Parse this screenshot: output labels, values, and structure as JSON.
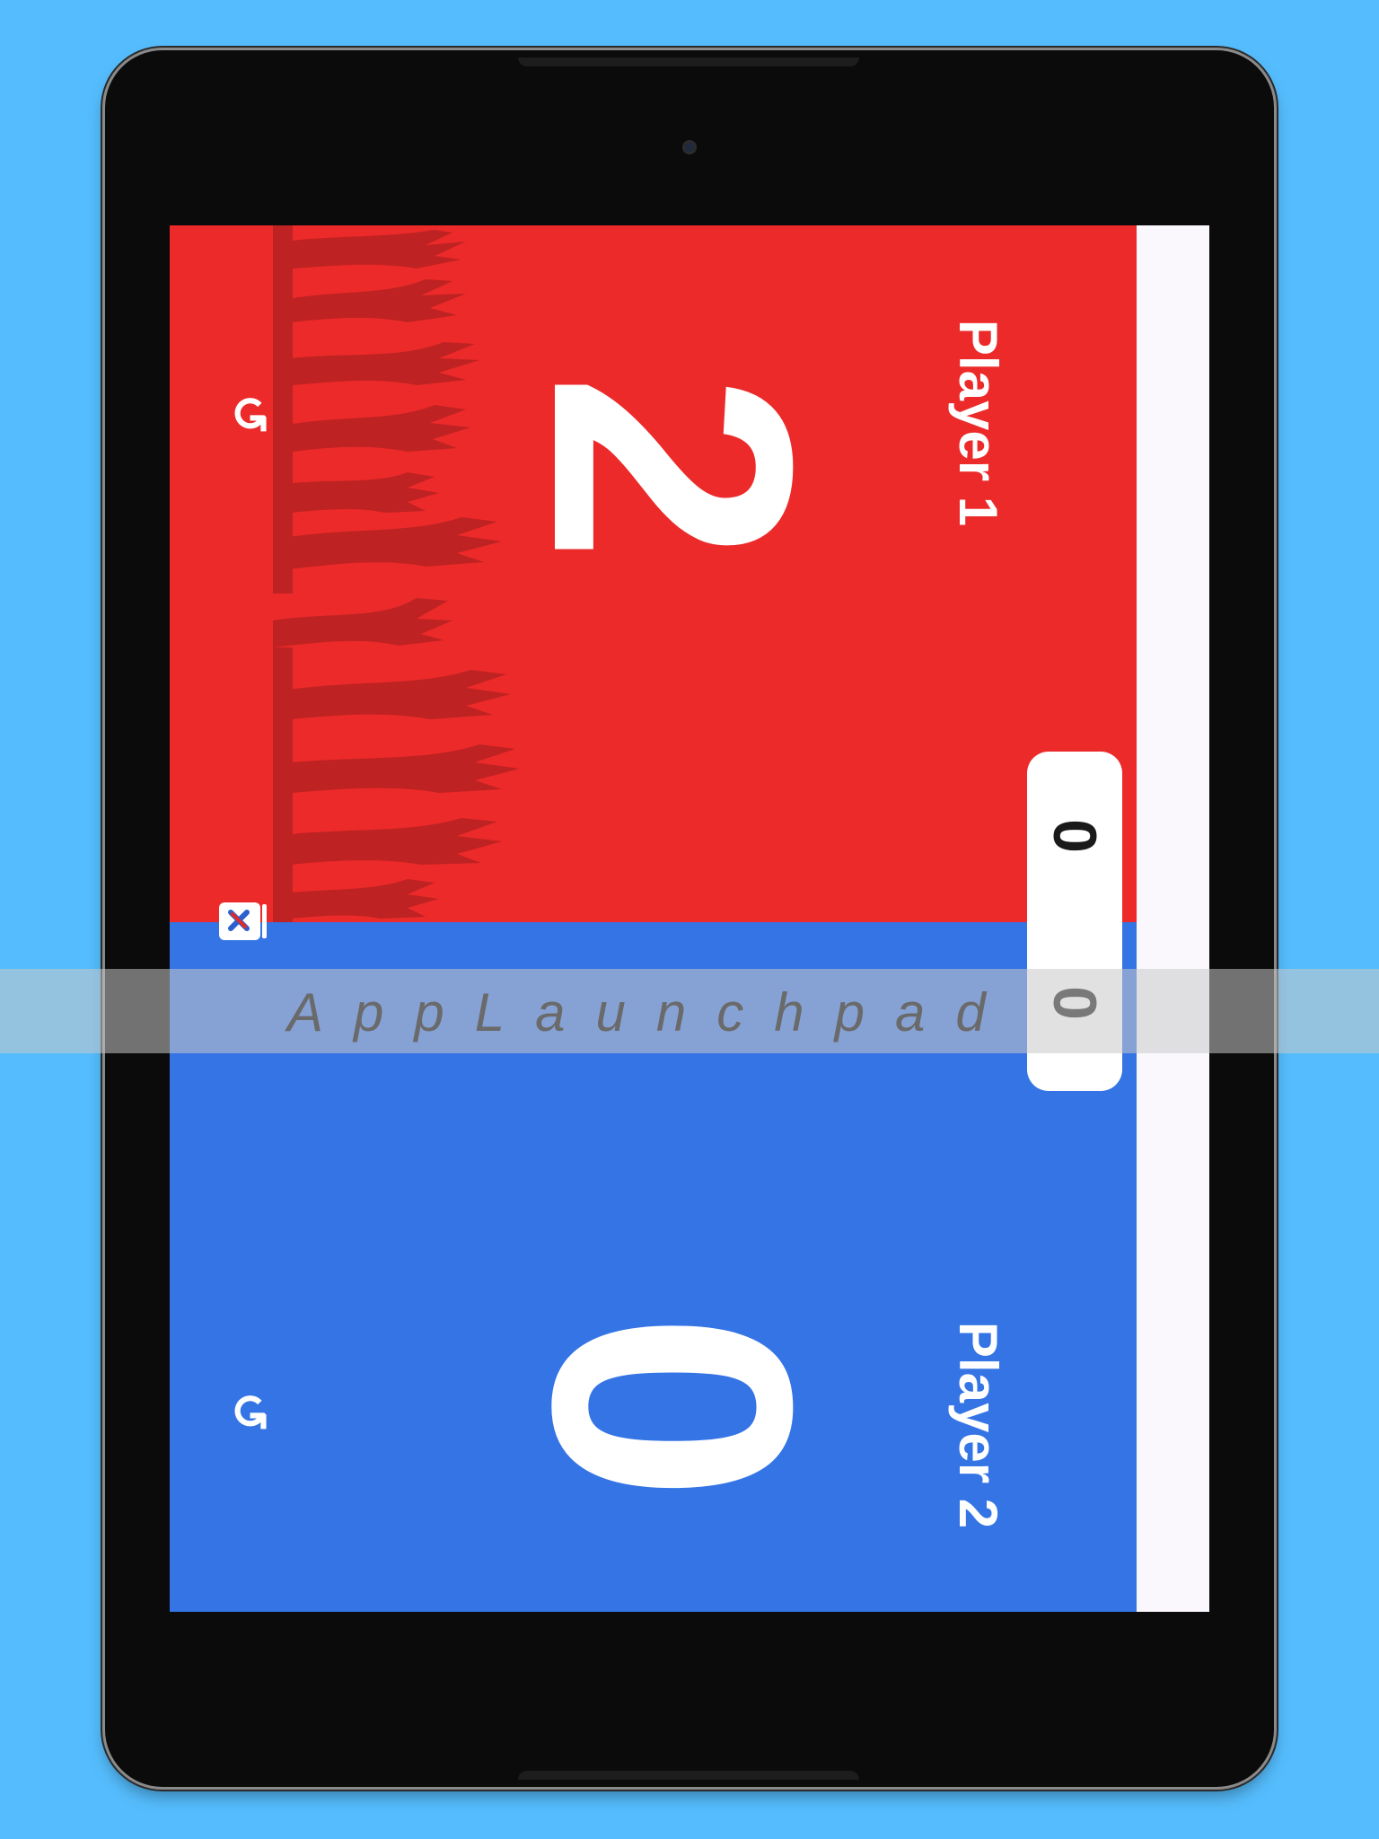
{
  "players": [
    {
      "name": "Player 1",
      "score": "2",
      "color": "#ec2a2a"
    },
    {
      "name": "Player 2",
      "score": "0",
      "color": "#3574e5"
    }
  ],
  "round_scores": {
    "top": "0",
    "bottom": "0"
  },
  "watermark": "AppLaunchpad",
  "icons": {
    "undo": "undo-icon",
    "reset": "reset-icon"
  },
  "colors": {
    "background": "#55bdfd",
    "red": "#ec2a2a",
    "blue": "#3574e5",
    "screen": "#fbf8fd"
  }
}
